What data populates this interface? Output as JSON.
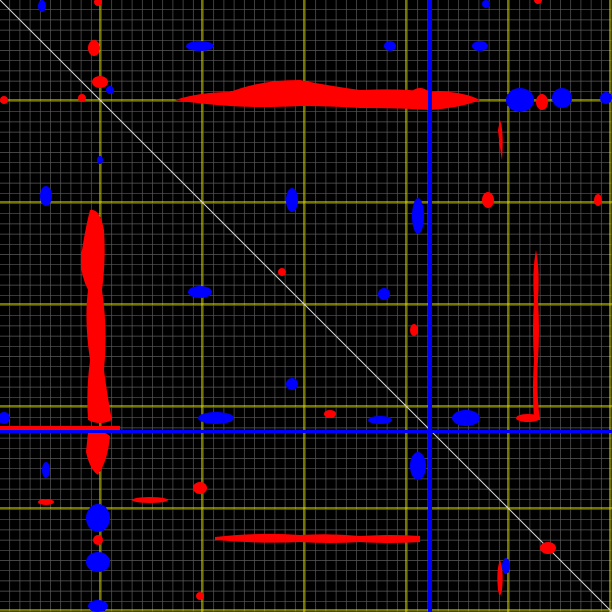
{
  "view": {
    "background": "#000000",
    "minor_grid_color": "#5a5a5a",
    "major_grid_color": "#e8e800",
    "diagonal_color": "#d8d8d8",
    "positive_color": "#ff0000",
    "negative_color": "#0000ff"
  }
}
